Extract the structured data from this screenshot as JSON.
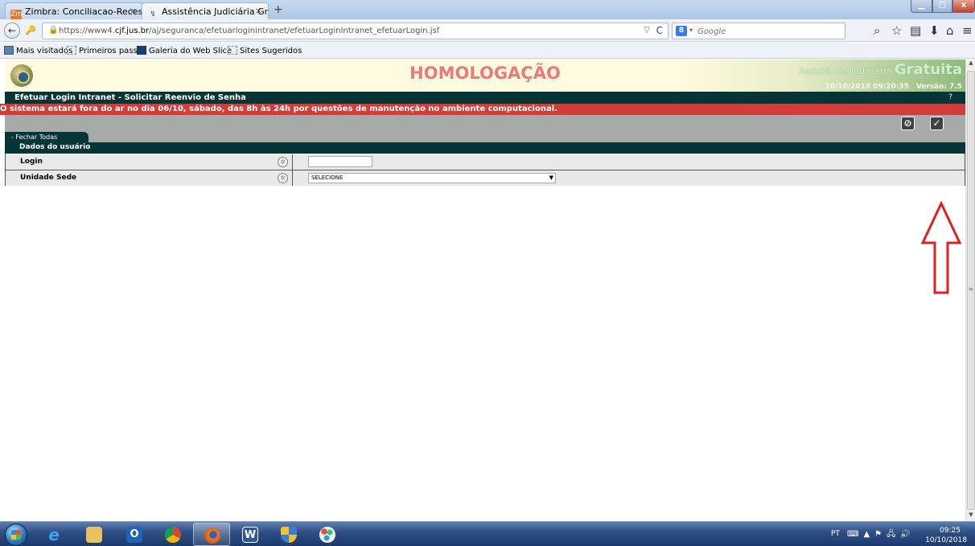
{
  "browser": {
    "tabs": [
      {
        "label": "Zimbra: Conciliacao-Reces...",
        "icon": "zimbra-icon",
        "close": "×"
      },
      {
        "label": "Assistência Judiciária Gratu...",
        "icon": "page-icon",
        "close": "×"
      }
    ],
    "new_tab": "+",
    "url_prefix": "https://www4.",
    "url_domain": "cjf.jus.br",
    "url_path": "/aj/seguranca/efetuarloginintranet/efetuarLoginIntranet_efetuarLogin.jsf",
    "search_placeholder": "Google",
    "search_engine_letter": "8",
    "bookmarks": [
      "Mais visitados",
      "Primeiros passos",
      "Galeria do Web Slice",
      "Sites Sugeridos"
    ]
  },
  "app": {
    "banner": "HOMOLOGAÇÃO",
    "brand_small": "Assistência Judiciária",
    "brand_big": "Gratuita",
    "datetime": "10/10/2018 09:20:35",
    "version": "Versão: 7.5",
    "page_title": "Efetuar Login Intranet - Solicitar Reenvio de Senha",
    "help": "?",
    "alert": "O sistema estará fora do ar no dia 06/10, sábado, das 8h às 24h por questões de manutenção no ambiente computacional.",
    "tab_fechar": "- Fechar Todas",
    "section_title": "Dados do usuário",
    "fields": {
      "login_label": "Login",
      "login_value": "",
      "unidade_label": "Unidade Sede",
      "unidade_value": "SELECIONE"
    },
    "colors": {
      "dark_teal": "#053534",
      "alert_red": "#d53b37",
      "banner_pink": "#ec7a7a",
      "annotation_red": "#e02020"
    }
  },
  "taskbar": {
    "apps": [
      "internet-explorer-icon",
      "file-explorer-icon",
      "outlook-icon",
      "chrome-icon",
      "firefox-icon",
      "word-icon",
      "security-shield-icon",
      "paint-icon"
    ],
    "lang": "PT",
    "time": "09:25",
    "date": "10/10/2018"
  }
}
